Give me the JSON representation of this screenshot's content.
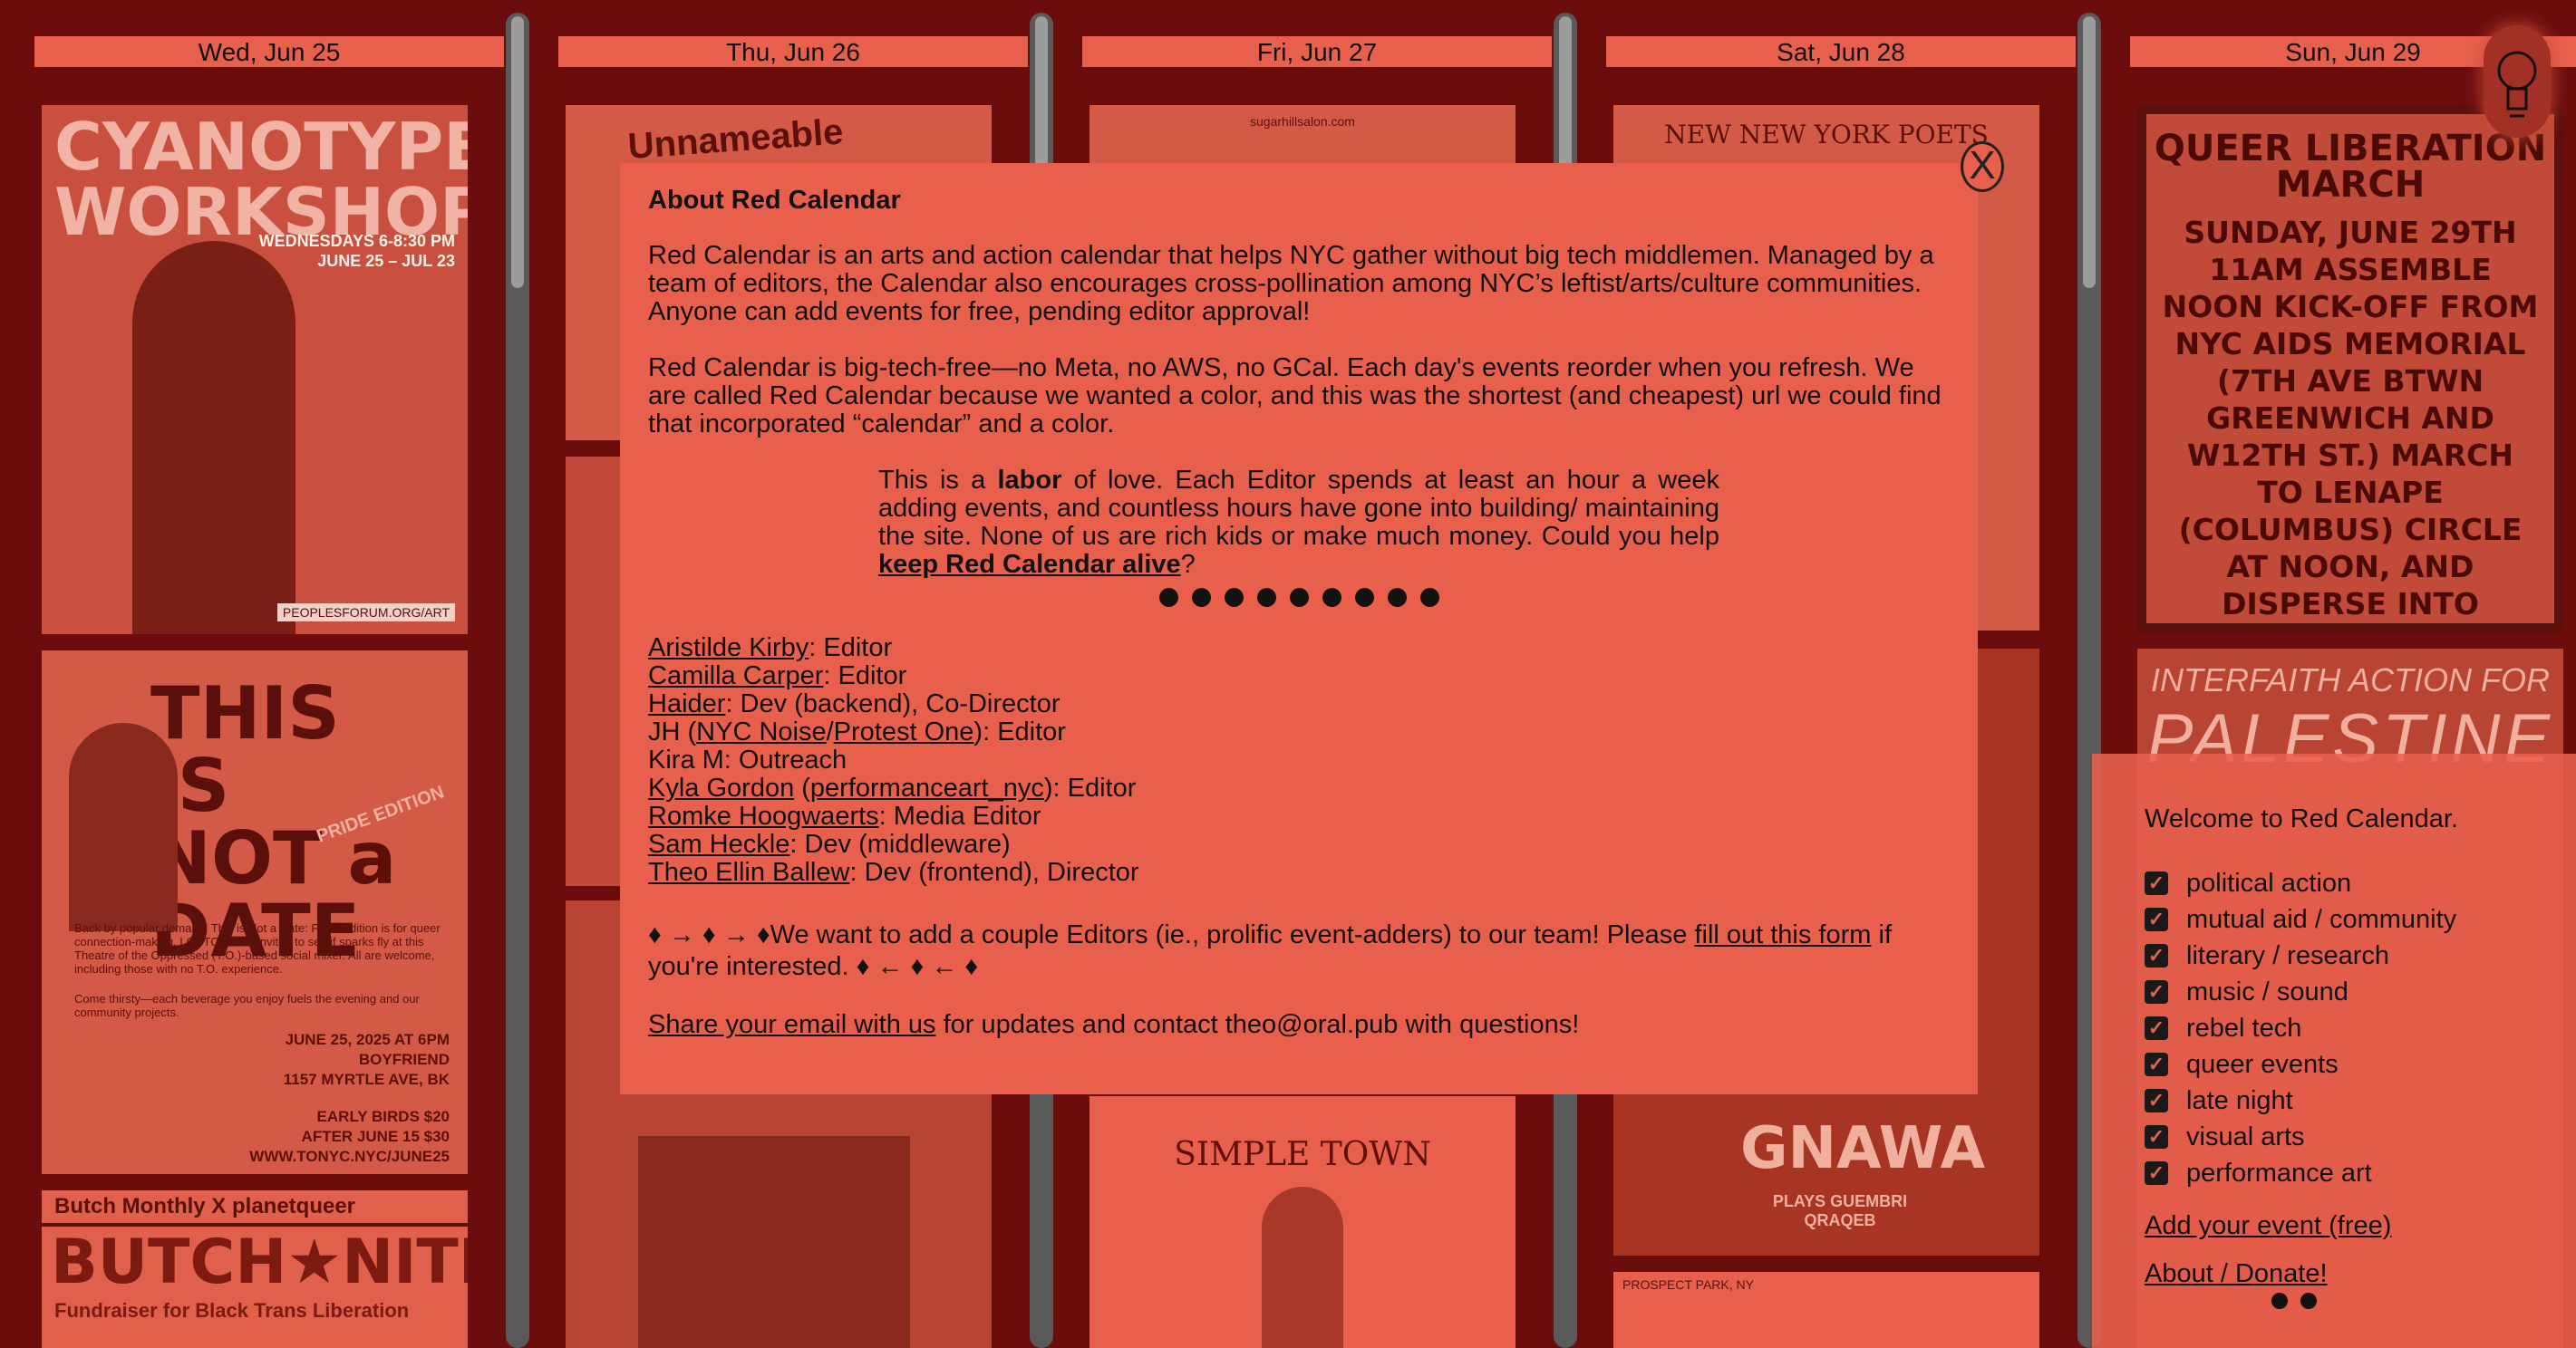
{
  "days": [
    {
      "label": "Wed, Jun 25"
    },
    {
      "label": "Thu, Jun 26"
    },
    {
      "label": "Fri, Jun 27"
    },
    {
      "label": "Sat, Jun 28"
    },
    {
      "label": "Sun, Jun 29"
    }
  ],
  "posters": {
    "cyanotype": {
      "title": "CYANOTYPE WORKSHOP",
      "dates": "WEDNESDAYS 6-8:30 PM",
      "range": "JUNE 25 – JUL 23",
      "url": "PEOPLESFORUM.ORG/ART"
    },
    "notadate": {
      "title": "THIS IS NOT a DATE",
      "sub": "PRIDE EDITION",
      "blurb": "Back by popular demand! This is Not a Date: Pride Edition is for queer connection-making. LGBTQ+ folks invited to see if sparks fly at this Theatre of the Oppressed (T.O.)-based social mixer. All are welcome, including those with no T.O. experience.",
      "blurb2": "Come thirsty—each beverage you enjoy fuels the evening and our community projects.",
      "date": "JUNE 25, 2025 AT 6PM",
      "venue": "BOYFRIEND",
      "address": "1157 MYRTLE AVE, BK",
      "early": "EARLY BIRDS $20",
      "after": "AFTER JUNE 15 $30",
      "web": "WWW.TONYC.NYC/JUNE25"
    },
    "butch": {
      "top": "Butch Monthly X planetqueer",
      "title": "BUTCH★NITE★OUT",
      "sub": "Fundraiser for Black Trans Liberation"
    },
    "greetings": {
      "title": "Unnameable Greetings"
    },
    "sugarhill": {
      "url": "sugarhillsalon.com"
    },
    "simpletown": {
      "title": "SIMPLE TOWN"
    },
    "nynypoets": {
      "title": "NEW NEW YORK POETS"
    },
    "gnawa": {
      "title": "GNAWA",
      "sub": "PLAYS GUEMBRI QRAQEB"
    },
    "prospect": {
      "text": "PROSPECT PARK, NY"
    },
    "queerlib": {
      "title": "QUEER LIBERATION MARCH",
      "body": "SUNDAY, JUNE 29TH 11AM ASSEMBLE NOON KICK-OFF FROM NYC AIDS MEMORIAL (7TH AVE BTWN GREENWICH AND W12TH ST.) MARCH TO LENAPE (COLUMBUS) CIRCLE AT NOON, AND DISPERSE INTO CENTRAL PARK"
    },
    "interfaith": {
      "title": "INTERFAITH ACTION FOR",
      "big": "PALESTINE"
    }
  },
  "modal": {
    "title": "About Red Calendar",
    "p1": "Red Calendar is an arts and action calendar that helps NYC gather without big tech middlemen. Managed by a team of editors, the Calendar also encourages cross-pollination among NYC’s leftist/arts/culture communities. Anyone can add events for free, pending editor approval!",
    "p2": "Red Calendar is big-tech-free—no Meta, no AWS, no GCal. Each day's events reorder when you refresh. We are called Red Calendar because we wanted a color, and this was the shortest (and cheapest) url we could find that incorporated “calendar” and a color.",
    "labor_pre": "This is a ",
    "labor_bold": "labor",
    "labor_post": " of love. Each Editor spends at least an hour a week adding events, and countless hours have gone into building/ maintaining the site. None of us are rich kids or make much money. Could you help ",
    "labor_link": "keep Red Calendar alive",
    "labor_end": "?",
    "team": [
      {
        "name": "Aristilde Kirby",
        "role": ": Editor"
      },
      {
        "name": "Camilla Carper",
        "role": ": Editor"
      },
      {
        "name": "Haider",
        "role": ": Dev (backend), Co-Director"
      },
      {
        "name": "Kira M: Outreach",
        "role": ""
      },
      {
        "name": "Kyla Gordon",
        "extra": "performanceart_nyc",
        "role": ": Editor"
      },
      {
        "name": "Romke Hoogwaerts",
        "role": ": Media Editor"
      },
      {
        "name": "Sam Heckle",
        "role": ": Dev (middleware)"
      },
      {
        "name": "Theo Ellin Ballew",
        "role": ": Dev (frontend), Director"
      }
    ],
    "jh": {
      "prefix": "JH (",
      "link1": "NYC Noise",
      "sep": "/",
      "link2": "Protest One",
      "suffix": "): Editor"
    },
    "recruit_pre": "♦ → ♦ → ♦We want to add a couple Editors (ie., prolific event-adders) to our team! Please ",
    "recruit_link": "fill out this form",
    "recruit_post": " if you're interested. ♦ ← ♦ ← ♦",
    "email_link": "Share your email with us",
    "email_post": " for updates and contact theo@oral.pub with questions!",
    "close_label": "X"
  },
  "panel": {
    "welcome": "Welcome to Red Calendar.",
    "filters": [
      {
        "label": "political action",
        "checked": true
      },
      {
        "label": "mutual aid / community",
        "checked": true
      },
      {
        "label": "literary / research",
        "checked": true
      },
      {
        "label": "music / sound",
        "checked": true
      },
      {
        "label": "rebel tech",
        "checked": true
      },
      {
        "label": "queer events",
        "checked": true
      },
      {
        "label": "late night",
        "checked": true
      },
      {
        "label": "visual arts",
        "checked": true
      },
      {
        "label": "performance art",
        "checked": true
      }
    ],
    "add_event": "Add your event (free)",
    "about": "About / Donate!"
  },
  "colors": {
    "background": "#6b0d0d",
    "accent": "#e8604c",
    "text": "#111111"
  }
}
